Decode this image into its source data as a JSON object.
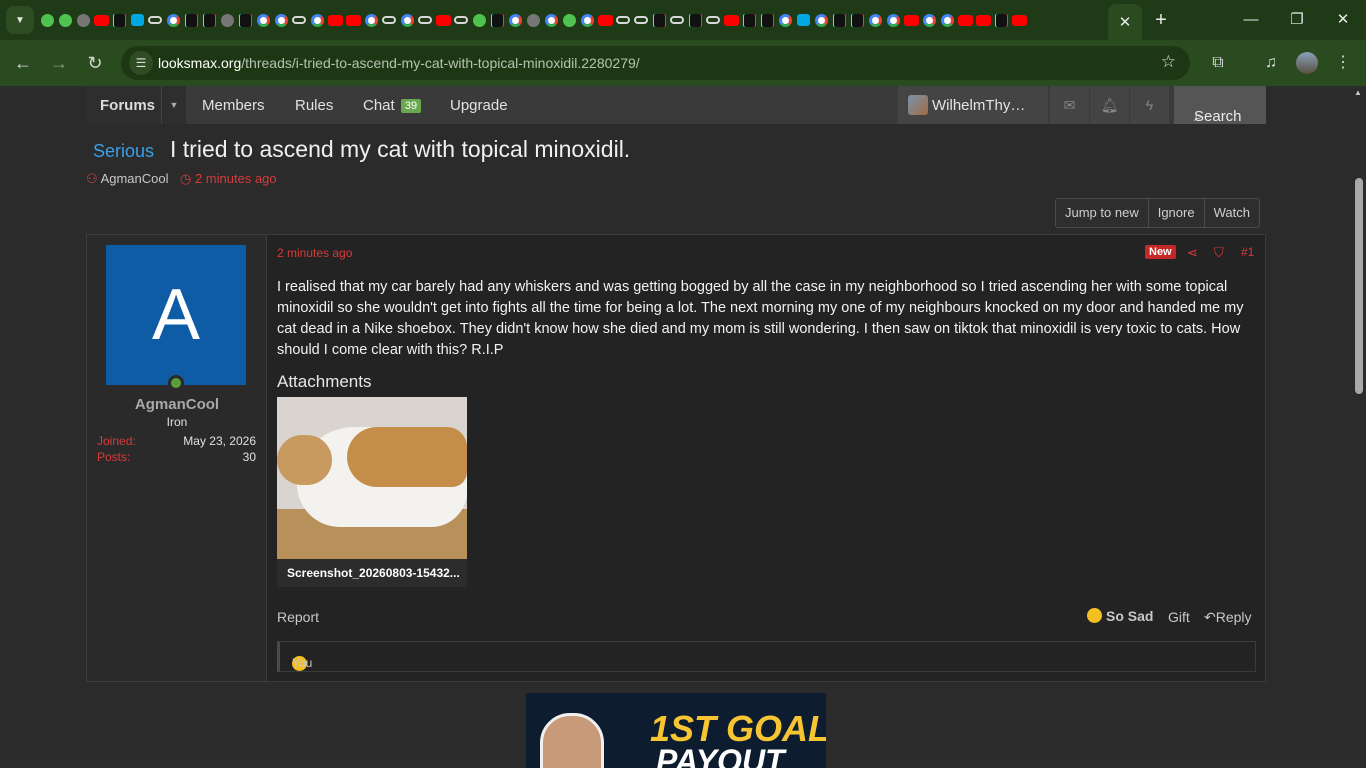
{
  "browser": {
    "active_tab_close": "✕",
    "new_tab": "+",
    "url_domain": "looksmax.org",
    "url_path": "/threads/i-tried-to-ascend-my-cat-with-topical-minoxidil.2280279/",
    "tab_favicons": [
      "pl",
      "pl",
      "gl",
      "yt",
      "tt",
      "tw",
      "inf",
      "g",
      "tt",
      "tt",
      "gl",
      "tt",
      "g",
      "g",
      "inf",
      "g",
      "yt",
      "yt",
      "g",
      "inf",
      "g",
      "inf",
      "yt",
      "inf",
      "pl",
      "tt",
      "g",
      "gl",
      "g",
      "pl",
      "g",
      "yt",
      "inf",
      "inf",
      "tt",
      "inf",
      "tt",
      "inf",
      "yt",
      "tt",
      "tt",
      "g",
      "tw",
      "g",
      "tt",
      "tt",
      "g",
      "g",
      "yt",
      "g",
      "g",
      "yt",
      "yt",
      "tt",
      "yt"
    ]
  },
  "site_nav": {
    "forums": "Forums",
    "members": "Members",
    "rules": "Rules",
    "chat": "Chat",
    "chat_count": "39",
    "upgrade": "Upgrade",
    "username": "WilhelmThy…",
    "search": "Search"
  },
  "thread": {
    "prefix": "Serious",
    "title": "I tried to ascend my cat with topical minoxidil.",
    "author": "AgmanCool",
    "time": "2 minutes ago",
    "buttons": [
      "Jump to new",
      "Ignore",
      "Watch"
    ]
  },
  "post": {
    "avatar_letter": "A",
    "username": "AgmanCool",
    "rank": "Iron",
    "joined_label": "Joined:",
    "joined_value": "May 23, 2026",
    "posts_label": "Posts:",
    "posts_value": "30",
    "time": "2 minutes ago",
    "new_badge": "New",
    "number": "#1",
    "body": "I realised that my car barely had any whiskers and was getting bogged by all the case in my neighborhood so I tried ascending her with some topical minoxidil so she wouldn't get into fights all the time for being a lot. The next morning my one of my neighbours knocked on my door and handed me my cat dead in a Nike shoebox. They didn't know how she died and my mom is still wondering. I then saw on tiktok that minoxidil is very toxic to cats. How should I come clear with this? R.I.P",
    "attachments_heading": "Attachments",
    "attachment_name": "Screenshot_20260803-15432...",
    "report": "Report",
    "reaction_given": "So Sad",
    "gift": "Gift",
    "reply": "Reply",
    "reactions_by": "You"
  },
  "ad": {
    "line1": "1ST GOAL",
    "line2": "PAYOUT"
  },
  "colors": {
    "browser_frame": "#1e3a16",
    "accent_red": "#d93a3a",
    "prefix_blue": "#3aa0e8",
    "avatar_blue": "#0f5ca6",
    "chat_badge": "#6aa84f"
  }
}
